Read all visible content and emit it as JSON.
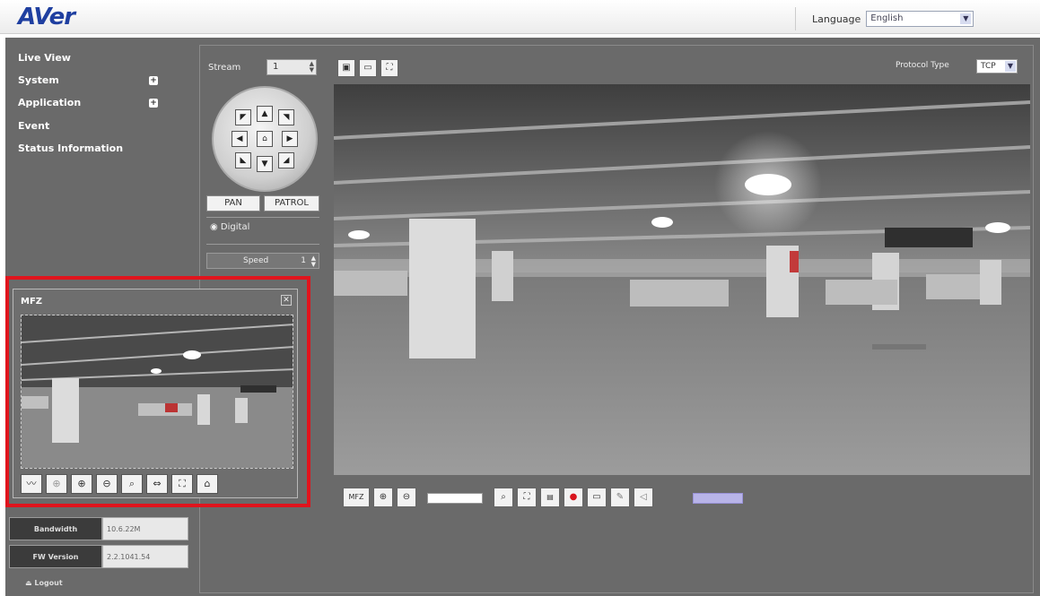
{
  "header": {
    "logo": "AVer",
    "language_label": "Language",
    "language_value": "English"
  },
  "sidebar": {
    "items": [
      {
        "label": "Live View"
      },
      {
        "label": "System",
        "expand": "+"
      },
      {
        "label": "Application",
        "expand": "+"
      },
      {
        "label": "Event"
      },
      {
        "label": "Status Information"
      }
    ],
    "info": [
      {
        "label": "Bandwidth",
        "value": "10.6.22M"
      },
      {
        "label": "FW Version",
        "value": "2.2.1041.54"
      }
    ],
    "logout_label": "Logout"
  },
  "controls": {
    "stream_label": "Stream",
    "stream_value": "1",
    "pan_label": "PAN",
    "patrol_label": "PATROL",
    "digital_label": "Digital",
    "speed_label": "Speed",
    "speed_value": "1",
    "protocol_label": "Protocol Type",
    "protocol_value": "TCP"
  },
  "mfz": {
    "title": "MFZ"
  },
  "video_toolbar": {
    "mfz_label": "MFZ"
  },
  "icons": {
    "ptz": [
      "arrow-up-left-icon",
      "arrow-up-icon",
      "arrow-up-right-icon",
      "arrow-left-icon",
      "home-icon",
      "arrow-right-icon",
      "arrow-down-left-icon",
      "arrow-down-icon",
      "arrow-down-right-icon"
    ],
    "view_modes": [
      "fit-view-icon",
      "original-size-icon",
      "fullscreen-icon"
    ]
  },
  "colors": {
    "highlight": "#e0141d",
    "panel": "#6a6a6a",
    "logo": "#1f3fa0",
    "record": "#d8141d"
  }
}
